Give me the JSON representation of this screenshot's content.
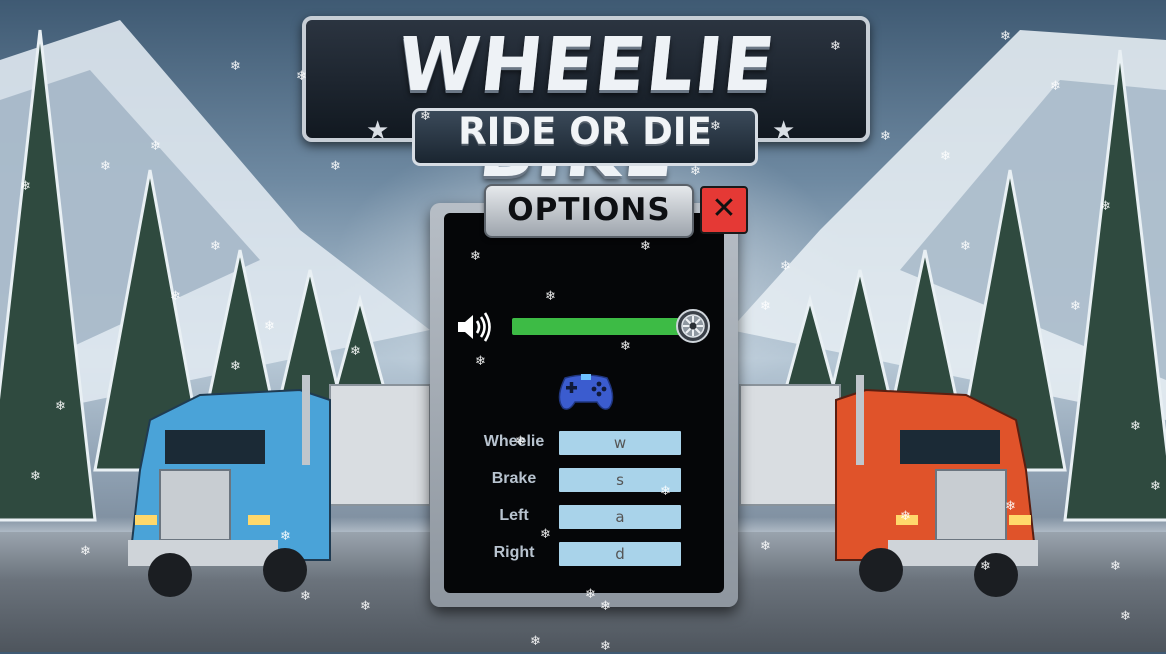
{
  "logo": {
    "title": "WHEELIE BIKE",
    "subtitle": "RIDE OR DIE"
  },
  "options": {
    "title": "OPTIONS",
    "close_label": "✕",
    "volume": {
      "icon": "speaker-icon",
      "level": 0.94,
      "knob_icon": "wheel-icon"
    },
    "controls_icon": "gamepad-icon",
    "bindings": [
      {
        "label": "Wheelie",
        "key": "w"
      },
      {
        "label": "Brake",
        "key": "s"
      },
      {
        "label": "Left",
        "key": "a"
      },
      {
        "label": "Right",
        "key": "d"
      }
    ]
  },
  "colors": {
    "slider_fill": "#3dbb45",
    "close_button": "#e53935",
    "key_field": "#a9d3ea",
    "label_text": "#b8c3cf",
    "truck_left": "#4aa3d8",
    "truck_right": "#e0532a"
  }
}
